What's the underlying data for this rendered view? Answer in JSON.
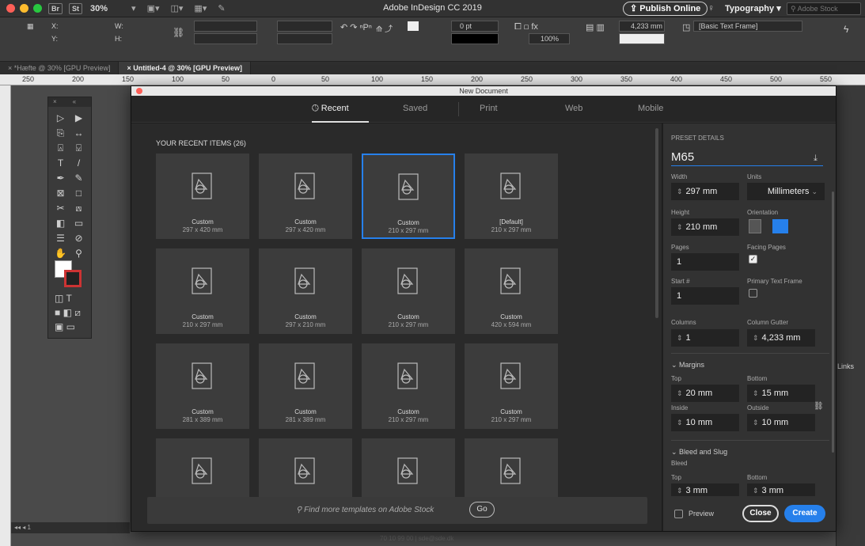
{
  "titlebar": {
    "badge_br": "Br",
    "badge_st": "St",
    "zoom": "30%",
    "app_title": "Adobe InDesign CC 2019",
    "publish_online": "Publish Online",
    "workspace": "Typography",
    "stock_search_placeholder": "Adobe Stock"
  },
  "controlbar": {
    "x_label": "X:",
    "y_label": "Y:",
    "w_label": "W:",
    "h_label": "H:",
    "stroke_weight": "0 pt",
    "opacity": "100%",
    "dimension": "4,233 mm",
    "frame_style": "[Basic Text Frame]"
  },
  "doc_tabs": [
    {
      "label": "*Hæfte @ 30% [GPU Preview]"
    },
    {
      "label": "Untitled-4 @ 30% [GPU Preview]"
    }
  ],
  "ruler": {
    "ticks": [
      "250",
      "200",
      "150",
      "100",
      "50",
      "0",
      "50",
      "100",
      "150",
      "200",
      "250",
      "300",
      "350",
      "400",
      "450",
      "500",
      "550"
    ]
  },
  "statusbar": {
    "page": "1"
  },
  "footer_text": "70 10 99 00 | sde@sde.dk",
  "right_panel": {
    "links_tab": "Links"
  },
  "dialog": {
    "title": "New Document",
    "tabs": {
      "recent": "Recent",
      "saved": "Saved",
      "print": "Print",
      "web": "Web",
      "mobile": "Mobile"
    },
    "recent_items_label": "YOUR RECENT ITEMS",
    "recent_items_count": "(26)",
    "tiles": [
      {
        "name": "Custom",
        "size": "297 x 420 mm",
        "selected": false
      },
      {
        "name": "Custom",
        "size": "297 x 420 mm",
        "selected": false
      },
      {
        "name": "Custom",
        "size": "210 x 297 mm",
        "selected": true
      },
      {
        "name": "[Default]",
        "size": "210 x 297 mm",
        "selected": false
      },
      {
        "name": "Custom",
        "size": "210 x 297 mm",
        "selected": false
      },
      {
        "name": "Custom",
        "size": "297 x 210 mm",
        "selected": false
      },
      {
        "name": "Custom",
        "size": "210 x 297 mm",
        "selected": false
      },
      {
        "name": "Custom",
        "size": "420 x 594 mm",
        "selected": false
      },
      {
        "name": "Custom",
        "size": "281 x 389 mm",
        "selected": false
      },
      {
        "name": "Custom",
        "size": "281 x 389 mm",
        "selected": false
      },
      {
        "name": "Custom",
        "size": "210 x 297 mm",
        "selected": false
      },
      {
        "name": "Custom",
        "size": "210 x 297 mm",
        "selected": false
      },
      {
        "name": "",
        "size": "",
        "selected": false
      },
      {
        "name": "",
        "size": "",
        "selected": false
      },
      {
        "name": "",
        "size": "",
        "selected": false
      },
      {
        "name": "",
        "size": "",
        "selected": false
      }
    ],
    "stock_placeholder": "Find more templates on Adobe Stock",
    "go_label": "Go",
    "preset": {
      "header": "PRESET DETAILS",
      "name": "M65",
      "width_label": "Width",
      "width": "297 mm",
      "units_label": "Units",
      "units": "Millimeters",
      "height_label": "Height",
      "height": "210 mm",
      "orientation_label": "Orientation",
      "pages_label": "Pages",
      "pages": "1",
      "facing_label": "Facing Pages",
      "facing_checked": true,
      "start_label": "Start #",
      "start": "1",
      "primary_frame_label": "Primary Text Frame",
      "primary_frame_checked": false,
      "columns_label": "Columns",
      "columns": "1",
      "gutter_label": "Column Gutter",
      "gutter": "4,233 mm",
      "margins_label": "Margins",
      "top_label": "Top",
      "top": "20 mm",
      "bottom_label": "Bottom",
      "bottom": "15 mm",
      "inside_label": "Inside",
      "inside": "10 mm",
      "outside_label": "Outside",
      "outside": "10 mm",
      "bleed_slug_label": "Bleed and Slug",
      "bleed_label": "Bleed",
      "bleed_top_label": "Top",
      "bleed_top": "3 mm",
      "bleed_bottom_label": "Bottom",
      "bleed_bottom": "3 mm",
      "preview_label": "Preview",
      "close_label": "Close",
      "create_label": "Create"
    }
  },
  "colors": {
    "accent": "#2680eb",
    "dialog_bg": "#1e1e1e",
    "tile_bg": "#3c3c3c"
  }
}
